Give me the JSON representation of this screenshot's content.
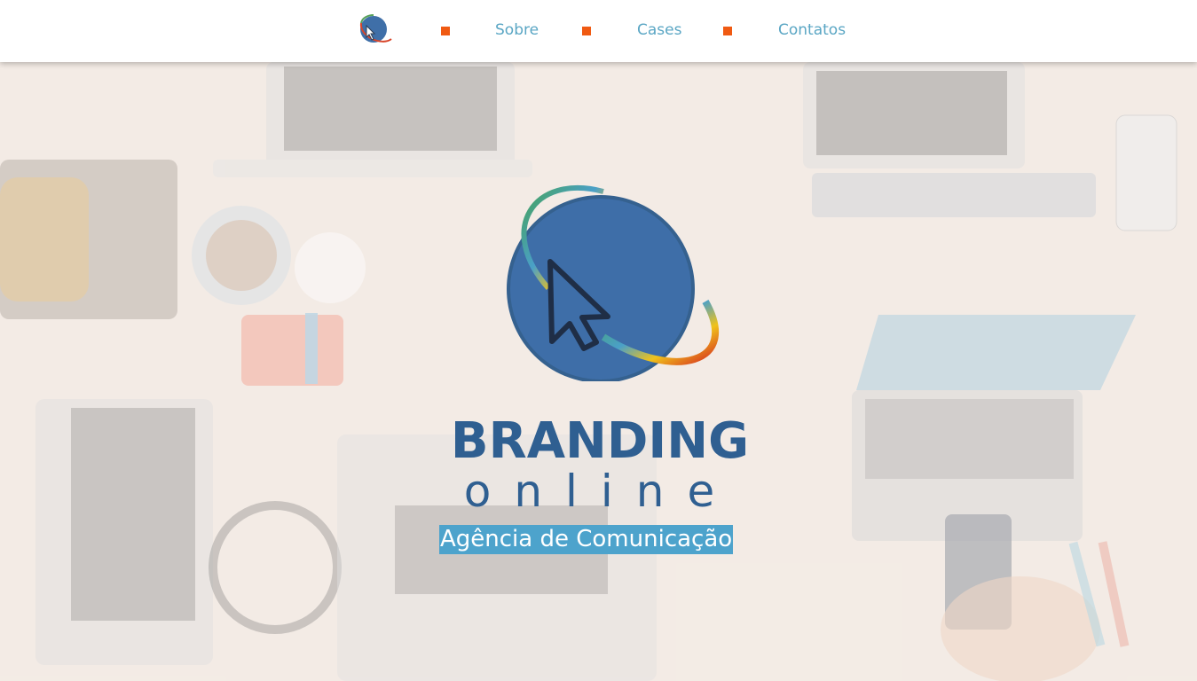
{
  "nav": {
    "logo_icon": "globe-cursor-logo-icon",
    "links": [
      {
        "label": "Sobre"
      },
      {
        "label": "Cases"
      },
      {
        "label": "Contatos"
      }
    ],
    "bullet_color": "#f05a12",
    "link_color": "#5aa6c4"
  },
  "hero": {
    "brand_title": "BRANDING",
    "brand_subtitle": "online",
    "tagline": "Agência de Comunicação",
    "brand_color": "#2f5f91",
    "tagline_bg": "#4da3cc",
    "background_image": "desk-with-laptops-photo"
  }
}
